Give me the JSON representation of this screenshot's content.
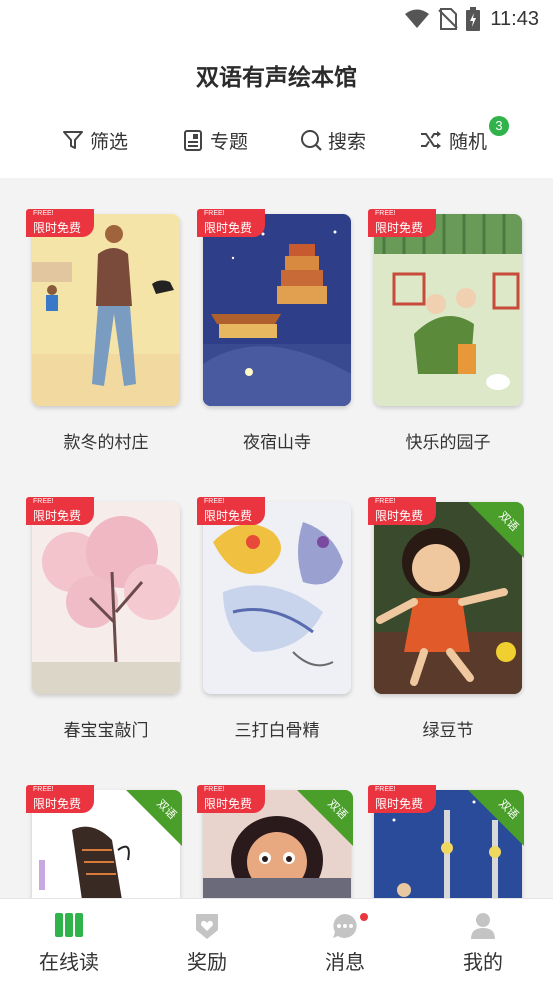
{
  "status_bar": {
    "time": "11:43",
    "icons": [
      "wifi-icon",
      "no-sim-icon",
      "battery-charging-icon"
    ]
  },
  "app": {
    "title": "双语有声绘本馆"
  },
  "toolbar": {
    "filter_label": "筛选",
    "topics_label": "专题",
    "search_label": "搜索",
    "random_label": "随机",
    "random_badge": "3"
  },
  "books": [
    {
      "title": "款冬的村庄",
      "free_tag": "FREE!",
      "promo": "限时免费",
      "bilingual": false
    },
    {
      "title": "夜宿山寺",
      "free_tag": "FREE!",
      "promo": "限时免费",
      "bilingual": false
    },
    {
      "title": "快乐的园子",
      "free_tag": "FREE!",
      "promo": "限时免费",
      "bilingual": false
    },
    {
      "title": "春宝宝敲门",
      "free_tag": "FREE!",
      "promo": "限时免费",
      "bilingual": false
    },
    {
      "title": "三打白骨精",
      "free_tag": "FREE!",
      "promo": "限时免费",
      "bilingual": false
    },
    {
      "title": "绿豆节",
      "free_tag": "FREE!",
      "promo": "限时免费",
      "bilingual": true,
      "bilingual_label": "双语"
    },
    {
      "title": "",
      "free_tag": "FREE!",
      "promo": "限时免费",
      "bilingual": true,
      "bilingual_label": "双语"
    },
    {
      "title": "",
      "free_tag": "FREE!",
      "promo": "限时免费",
      "bilingual": true,
      "bilingual_label": "双语"
    },
    {
      "title": "",
      "free_tag": "FREE!",
      "promo": "限时免费",
      "bilingual": true,
      "bilingual_label": "双语"
    }
  ],
  "tabbar": {
    "items": [
      {
        "label": "在线读",
        "icon": "books-icon",
        "active": true
      },
      {
        "label": "奖励",
        "icon": "reward-icon",
        "active": false
      },
      {
        "label": "消息",
        "icon": "message-icon",
        "active": false,
        "dot": true
      },
      {
        "label": "我的",
        "icon": "profile-icon",
        "active": false
      }
    ]
  },
  "colors": {
    "accent_green": "#2fb34a",
    "promo_red": "#ea3540",
    "bilingual_green": "#4a9e2a",
    "background_gray": "#f3f3f3"
  }
}
